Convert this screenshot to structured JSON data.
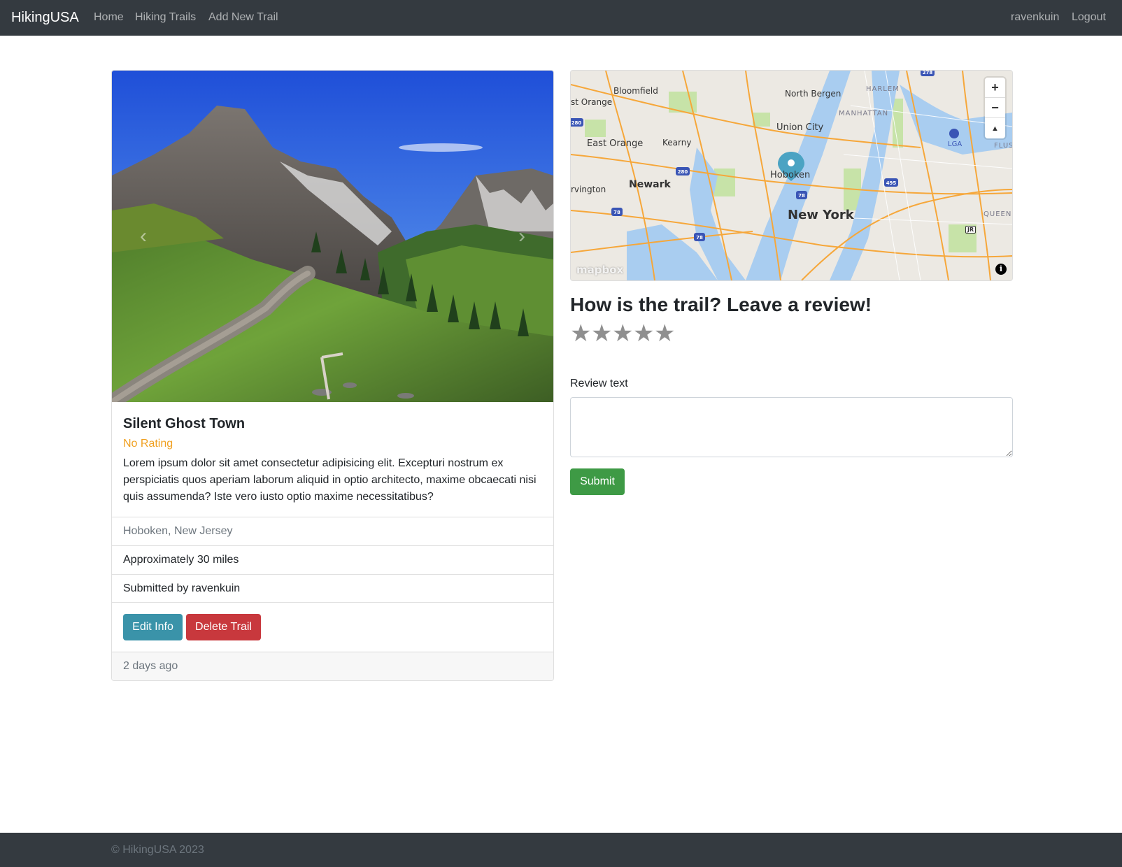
{
  "navbar": {
    "brand": "HikingUSA",
    "links": [
      "Home",
      "Hiking Trails",
      "Add New Trail"
    ],
    "user": "ravenkuin",
    "logout": "Logout"
  },
  "trail": {
    "title": "Silent Ghost Town",
    "rating": "No Rating",
    "description": "Lorem ipsum dolor sit amet consectetur adipisicing elit. Excepturi nostrum ex perspiciatis quos aperiam laborum aliquid in optio architecto, maxime obcaecati nisi quis assumenda? Iste vero iusto optio maxime necessitatibus?",
    "location": "Hoboken, New Jersey",
    "length": "Approximately 30 miles",
    "submitted_by": "Submitted by ravenkuin",
    "edit_label": "Edit Info",
    "delete_label": "Delete Trail",
    "time_ago": "2 days ago"
  },
  "carousel": {
    "prev_icon": "chevron-left-icon",
    "next_icon": "chevron-right-icon"
  },
  "map": {
    "labels": {
      "bloomfield": "Bloomfield",
      "north_bergen": "North Bergen",
      "harlem": "HARLEM",
      "orange": "st Orange",
      "manhattan": "MANHATTAN",
      "union_city": "Union City",
      "east_orange": "East Orange",
      "kearny": "Kearny",
      "lga": "LGA",
      "flus": "FLUS",
      "hoboken": "Hoboken",
      "newark": "Newark",
      "irvington": "rvington",
      "new_york": "New York",
      "queen": "QUEEN",
      "jr": "JR"
    },
    "highway_shields": [
      "278",
      "280",
      "280",
      "78",
      "495",
      "78",
      "78"
    ],
    "zoom_in": "+",
    "zoom_out": "−",
    "compass": "▲",
    "logo": "mapbox",
    "info": "i",
    "colors": {
      "water": "#a9cdf0",
      "land": "#ece9e3",
      "road": "#f6a73a",
      "park": "#c7e3a8",
      "marker": "#4ba3c3"
    }
  },
  "review": {
    "heading": "How is the trail? Leave a review!",
    "stars": [
      "★",
      "★",
      "★",
      "★",
      "★"
    ],
    "label": "Review text",
    "submit": "Submit"
  },
  "footer": {
    "copyright": "© HikingUSA 2023"
  },
  "colors": {
    "navbar": "#343a40",
    "info_button": "#3a93a9",
    "danger_button": "#c8383d",
    "success_button": "#3e9a45",
    "rating": "#f0a020"
  }
}
